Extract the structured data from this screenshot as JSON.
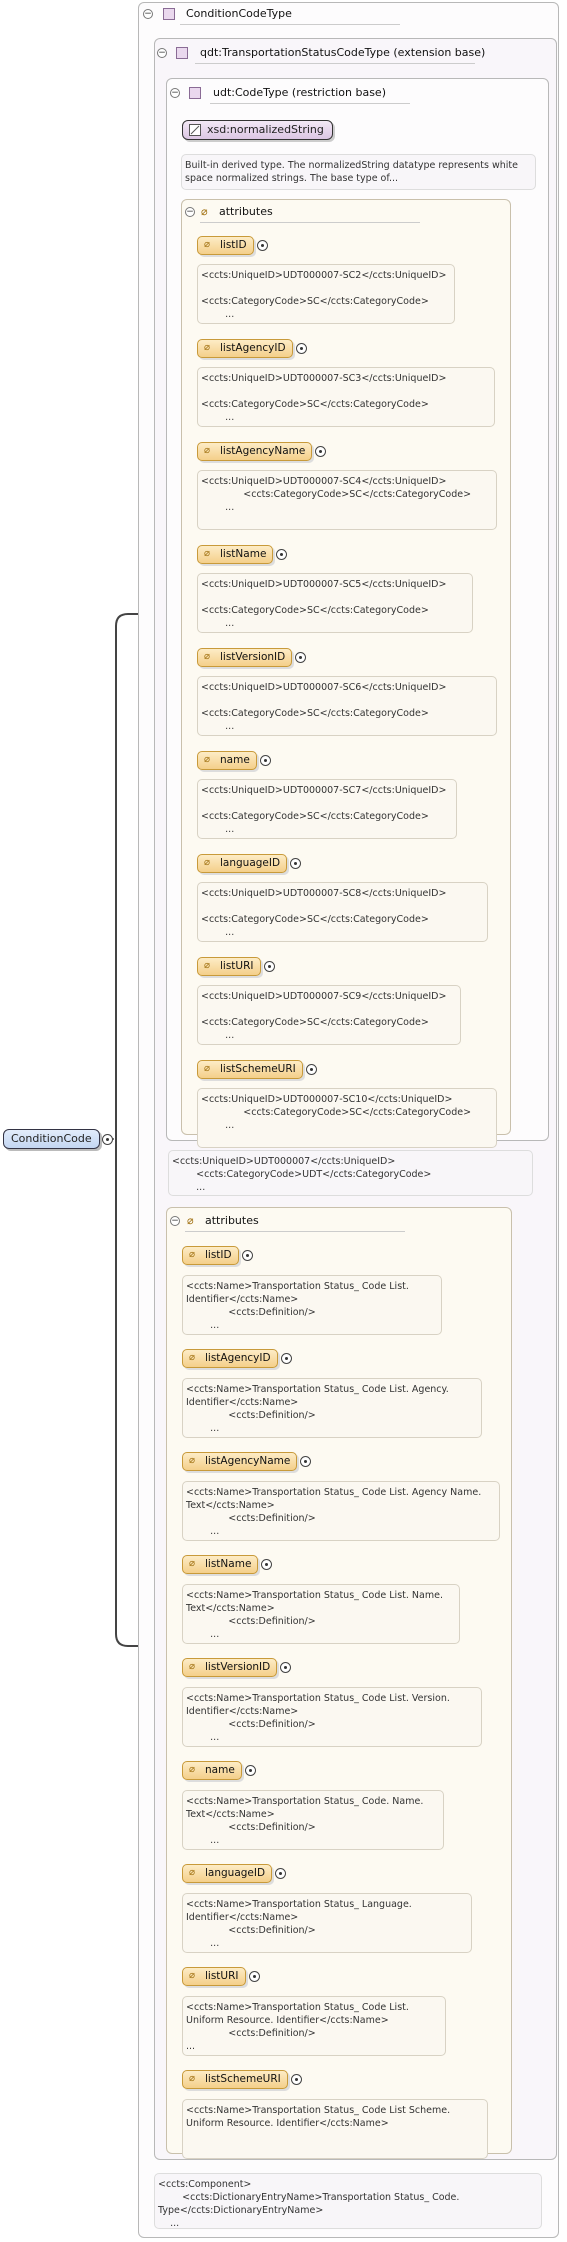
{
  "root": {
    "label": "ConditionCode"
  },
  "top": {
    "label": "ConditionCodeType"
  },
  "ext": {
    "label": "qdt:TransportationStatusCodeType (extension base)"
  },
  "restr": {
    "label": "udt:CodeType (restriction base)"
  },
  "xsd": {
    "label": "xsd:normalizedString",
    "doc": "Built-in derived type. The normalizedString datatype represents white\nspace normalized strings. The base type of..."
  },
  "inner_attributes": {
    "header": "attributes",
    "items": [
      {
        "name": "listID",
        "doc": "<ccts:UniqueID>UDT000007-SC2</ccts:UniqueID>\n\n<ccts:CategoryCode>SC</ccts:CategoryCode>\n        ..."
      },
      {
        "name": "listAgencyID",
        "doc": "<ccts:UniqueID>UDT000007-SC3</ccts:UniqueID>\n\n<ccts:CategoryCode>SC</ccts:CategoryCode>\n        ..."
      },
      {
        "name": "listAgencyName",
        "doc": "<ccts:UniqueID>UDT000007-SC4</ccts:UniqueID>\n              <ccts:CategoryCode>SC</ccts:CategoryCode>\n        ..."
      },
      {
        "name": "listName",
        "doc": "<ccts:UniqueID>UDT000007-SC5</ccts:UniqueID>\n\n<ccts:CategoryCode>SC</ccts:CategoryCode>\n        ..."
      },
      {
        "name": "listVersionID",
        "doc": "<ccts:UniqueID>UDT000007-SC6</ccts:UniqueID>\n\n<ccts:CategoryCode>SC</ccts:CategoryCode>\n        ..."
      },
      {
        "name": "name",
        "doc": "<ccts:UniqueID>UDT000007-SC7</ccts:UniqueID>\n\n<ccts:CategoryCode>SC</ccts:CategoryCode>\n        ..."
      },
      {
        "name": "languageID",
        "doc": "<ccts:UniqueID>UDT000007-SC8</ccts:UniqueID>\n\n<ccts:CategoryCode>SC</ccts:CategoryCode>\n        ..."
      },
      {
        "name": "listURI",
        "doc": "<ccts:UniqueID>UDT000007-SC9</ccts:UniqueID>\n\n<ccts:CategoryCode>SC</ccts:CategoryCode>\n        ..."
      },
      {
        "name": "listSchemeURI",
        "doc": "<ccts:UniqueID>UDT000007-SC10</ccts:UniqueID>\n              <ccts:CategoryCode>SC</ccts:CategoryCode>\n        ..."
      }
    ]
  },
  "ext_doc": "<ccts:UniqueID>UDT000007</ccts:UniqueID>\n        <ccts:CategoryCode>UDT</ccts:CategoryCode>\n        ...",
  "outer_attributes": {
    "header": "attributes",
    "items": [
      {
        "name": "listID",
        "doc": "<ccts:Name>Transportation Status_ Code List.\nIdentifier</ccts:Name>\n              <ccts:Definition/>\n        ..."
      },
      {
        "name": "listAgencyID",
        "doc": "<ccts:Name>Transportation Status_ Code List. Agency.\nIdentifier</ccts:Name>\n              <ccts:Definition/>\n        ..."
      },
      {
        "name": "listAgencyName",
        "doc": "<ccts:Name>Transportation Status_ Code List. Agency Name.\nText</ccts:Name>\n              <ccts:Definition/>\n        ..."
      },
      {
        "name": "listName",
        "doc": "<ccts:Name>Transportation Status_ Code List. Name.\nText</ccts:Name>\n              <ccts:Definition/>\n        ..."
      },
      {
        "name": "listVersionID",
        "doc": "<ccts:Name>Transportation Status_ Code List. Version.\nIdentifier</ccts:Name>\n              <ccts:Definition/>\n        ..."
      },
      {
        "name": "name",
        "doc": "<ccts:Name>Transportation Status_ Code. Name.\nText</ccts:Name>\n              <ccts:Definition/>\n        ..."
      },
      {
        "name": "languageID",
        "doc": "<ccts:Name>Transportation Status_ Language.\nIdentifier</ccts:Name>\n              <ccts:Definition/>\n        ..."
      },
      {
        "name": "listURI",
        "doc": "<ccts:Name>Transportation Status_ Code List.\nUniform Resource. Identifier</ccts:Name>\n              <ccts:Definition/>\n..."
      },
      {
        "name": "listSchemeURI",
        "doc": "<ccts:Name>Transportation Status_ Code List Scheme.\nUniform Resource. Identifier</ccts:Name>"
      }
    ]
  },
  "type_doc": "<ccts:Component>\n        <ccts:DictionaryEntryName>Transportation Status_ Code.\nType</ccts:DictionaryEntryName>\n    ..."
}
